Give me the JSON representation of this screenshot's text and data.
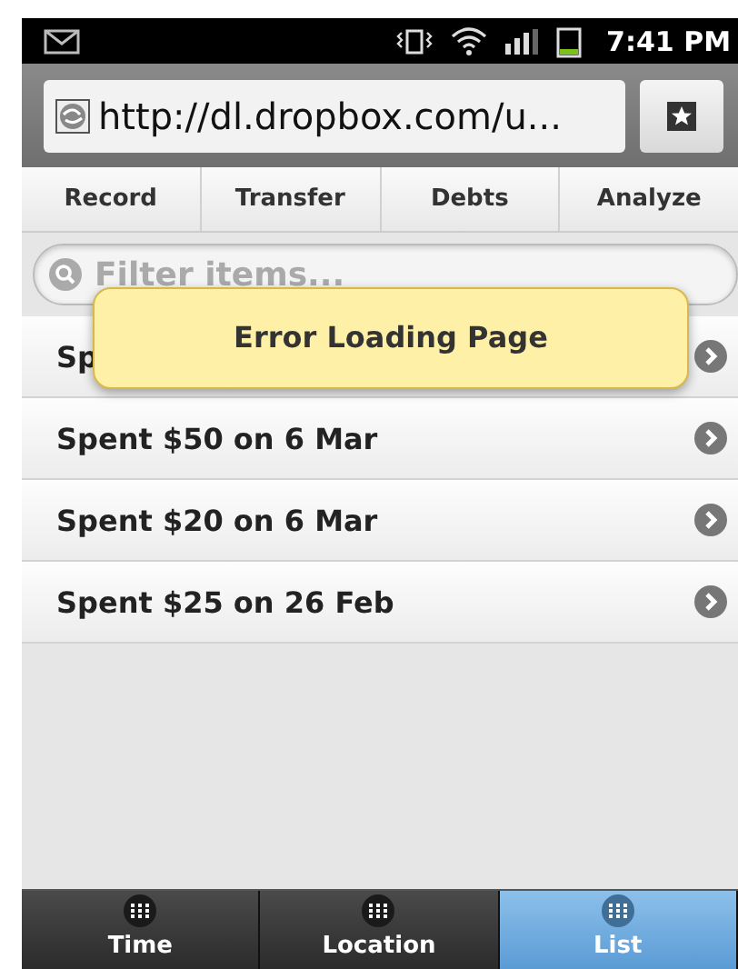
{
  "status_bar": {
    "time": "7:41 PM"
  },
  "browser": {
    "url": "http://dl.dropbox.com/u..."
  },
  "nav_tabs": [
    {
      "label": "Record"
    },
    {
      "label": "Transfer"
    },
    {
      "label": "Debts"
    },
    {
      "label": "Analyze"
    }
  ],
  "filter": {
    "placeholder": "Filter items..."
  },
  "items": [
    {
      "label": "Sp"
    },
    {
      "label": "Spent $50 on 6 Mar"
    },
    {
      "label": "Spent $20 on 6 Mar"
    },
    {
      "label": "Spent $25 on 26 Feb"
    }
  ],
  "toast": {
    "message": "Error Loading Page"
  },
  "bottom_tabs": [
    {
      "label": "Time",
      "selected": false
    },
    {
      "label": "Location",
      "selected": false
    },
    {
      "label": "List",
      "selected": true
    }
  ]
}
